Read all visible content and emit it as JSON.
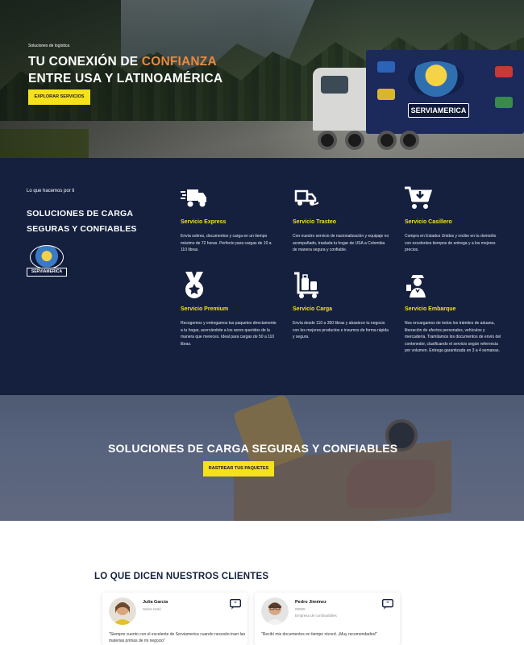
{
  "hero": {
    "kicker": "Soluciones de logística",
    "title_part1": "TU CONEXIÓN DE ",
    "title_accent": "CONFIANZA",
    "title_part2": " ENTRE USA Y LATINOAMÉRICA",
    "cta": "EXPLORAR SERVICIOS",
    "truck_brand": "SERVIAMERICA",
    "accent_color": "#e88a3c"
  },
  "services": {
    "kicker": "Lo que hacemos por ti",
    "title": "SOLUCIONES DE CARGA SEGURAS Y CONFIABLES",
    "logo_text": "SERVIAMERICA",
    "items": [
      {
        "icon": "truck-fast-icon",
        "name": "Servicio Express",
        "desc": "Envía sobres, documentos y carga en un tiempo máximo de 72 horas. Perfecto para cargas de 10 a 110 libras."
      },
      {
        "icon": "truck-ramp-icon",
        "name": "Servicio Trasteo",
        "desc": "Con nuestro servicio de nacionalización y equipaje no acompañado, traslada tu hogar de USA a Colombia de manera segura y confiable."
      },
      {
        "icon": "cart-download-icon",
        "name": "Servicio Casillero",
        "desc": "Compra en Estados Unidos y recibe en tu domicilio con excelentes tiempos de entrega y a los mejores precios."
      },
      {
        "icon": "medal-star-icon",
        "name": "Servicio Premium",
        "desc": "Recogemos y entregamos tus paquetes directamente a tu hogar, acercándote a los seres queridos de la manera que mereces. Ideal para cargas de 50 a 110 libras."
      },
      {
        "icon": "luggage-cart-icon",
        "name": "Servicio Carga",
        "desc": "Envía desde 110 a 350 libras y abastece tu negocio con los mejores productos e insumos de forma rápida y segura."
      },
      {
        "icon": "customs-officer-icon",
        "name": "Servicio Embarque",
        "desc": "Nos encargamos de todos los trámites de aduana, liberación de efectos personales, vehículos y mercadería. Tramitamos los documentos de envío del contenedor, clasificando el servicio según referencia por volumen. Entrega garantizada en 3 a 4 semanas."
      }
    ],
    "bg_color": "#14203e",
    "accent_color": "#f6e21b"
  },
  "banner": {
    "title": "SOLUCIONES DE CARGA SEGURAS Y CONFIABLES",
    "cta": "RASTREAR TUS PAQUETES"
  },
  "testimonials": {
    "title": "LO QUE DICEN NUESTROS CLIENTES",
    "items": [
      {
        "name": "Julia García",
        "role": "Señor testil",
        "text": "\"Siempre cuento con el excelente de Serviamerica cuando necesito traer las materias primas de mi negocio\""
      },
      {
        "name": "Pedro Jiménez",
        "role": "Empresa de combustibles",
        "rating": "00000",
        "text": "\"Recibí mis documentos en tiempo récord. ¡Muy recomendados!\""
      }
    ]
  }
}
